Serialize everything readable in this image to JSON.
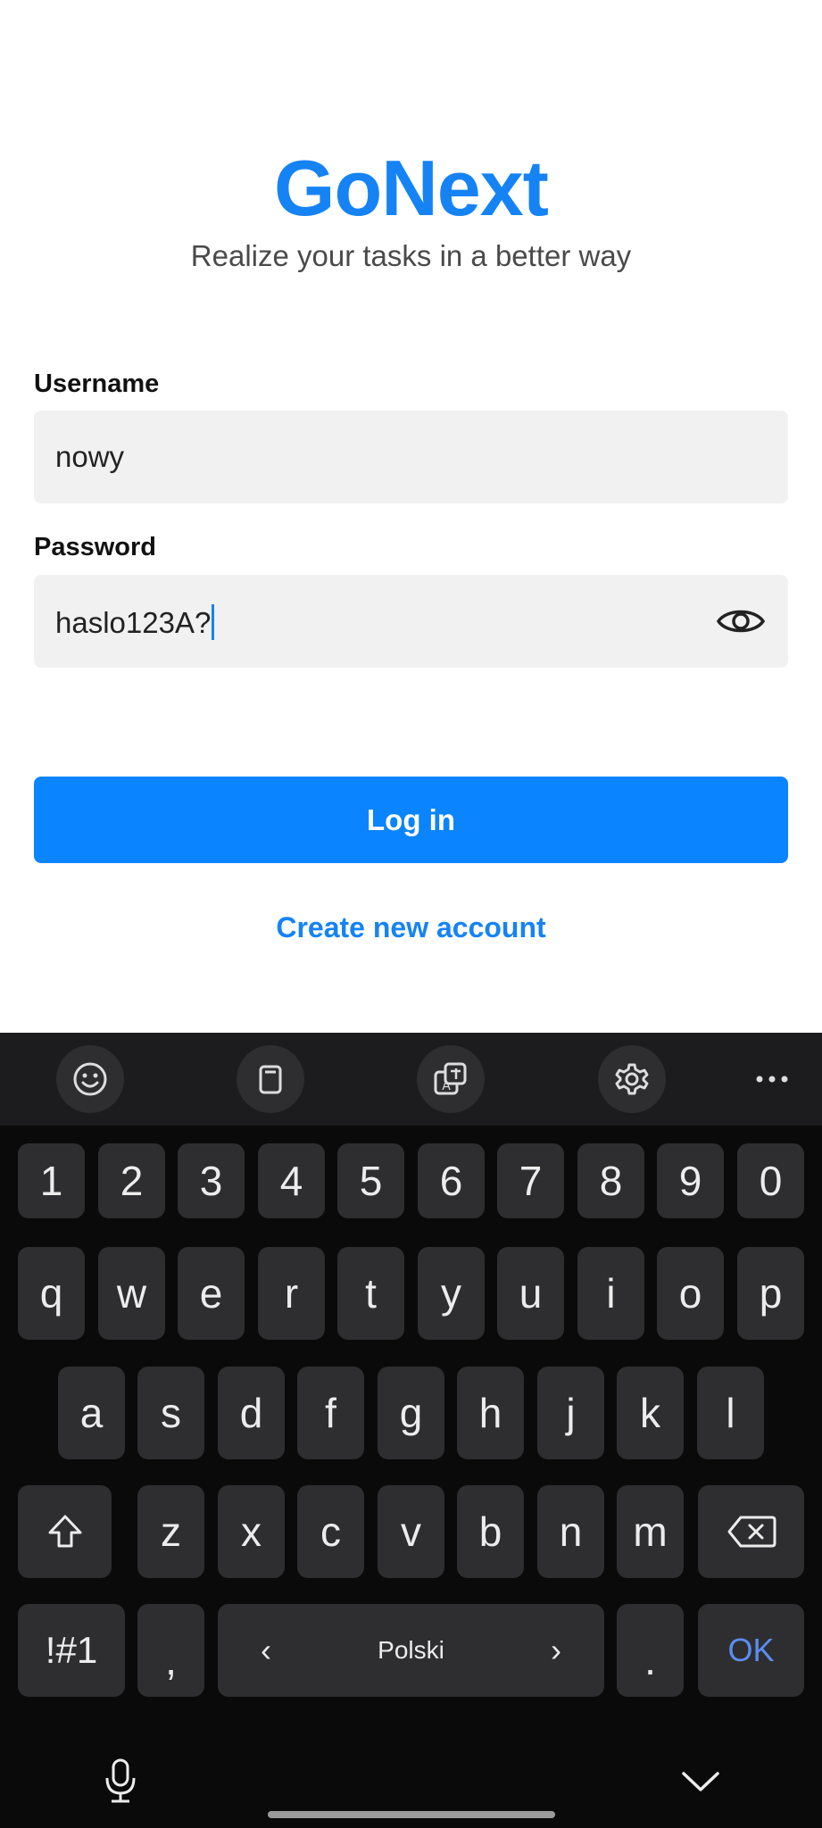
{
  "app": {
    "title": "GoNext",
    "subtitle": "Realize your tasks in a better way"
  },
  "form": {
    "username_label": "Username",
    "username_value": "nowy",
    "password_label": "Password",
    "password_value": "haslo123A?",
    "password_visibility_icon": "eye-icon",
    "login_label": "Log in",
    "create_account_label": "Create new account"
  },
  "colors": {
    "brand": "#1683f5",
    "button": "#0a84ff",
    "field_bg": "#f1f1f1",
    "keyboard_bg": "#0a0a0a",
    "key_bg": "#2e2e30"
  },
  "keyboard": {
    "toolbar_icons": [
      "emoji-icon",
      "clipboard-icon",
      "translate-icon",
      "settings-icon",
      "more-icon"
    ],
    "row_numbers": [
      "1",
      "2",
      "3",
      "4",
      "5",
      "6",
      "7",
      "8",
      "9",
      "0"
    ],
    "row_1": [
      "q",
      "w",
      "e",
      "r",
      "t",
      "y",
      "u",
      "i",
      "o",
      "p"
    ],
    "row_2": [
      "a",
      "s",
      "d",
      "f",
      "g",
      "h",
      "j",
      "k",
      "l"
    ],
    "row_3": [
      "z",
      "x",
      "c",
      "v",
      "b",
      "n",
      "m"
    ],
    "symbols_label": "!#1",
    "comma_label": ",",
    "space_label": "Polski",
    "space_left_arrow": "‹",
    "space_right_arrow": "›",
    "period_label": ".",
    "ok_label": "OK"
  }
}
